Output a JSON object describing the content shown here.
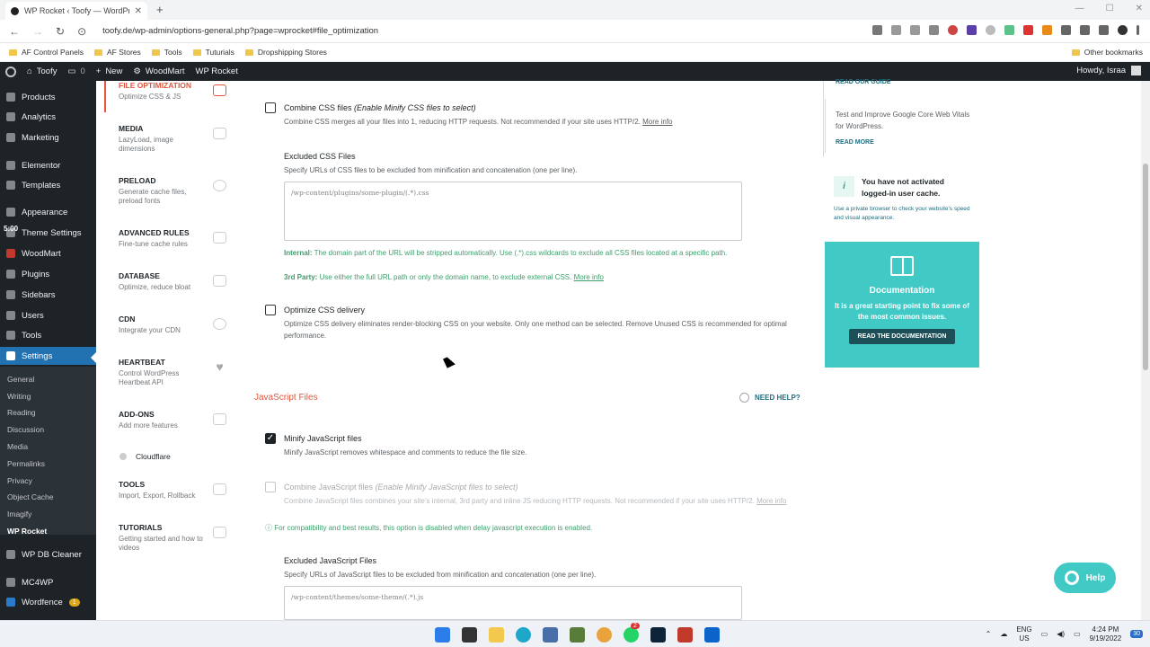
{
  "browser": {
    "tab_title": "WP Rocket ‹ Toofy — WordPress",
    "url": "toofy.de/wp-admin/options-general.php?page=wprocket#file_optimization",
    "bookmarks": [
      "AF Control Panels",
      "AF Stores",
      "Tools",
      "Tuturials",
      "Dropshipping Stores"
    ],
    "other_bookmarks": "Other bookmarks"
  },
  "adminbar": {
    "site": "Toofy",
    "comments": "0",
    "new": "New",
    "woodmart": "WoodMart",
    "wprocket": "WP Rocket",
    "howdy": "Howdy, Israa"
  },
  "wp_menu": {
    "items": [
      "Products",
      "Analytics",
      "Marketing",
      "Elementor",
      "Templates",
      "Appearance",
      "Theme Settings",
      "WoodMart",
      "Plugins",
      "Sidebars",
      "Users",
      "Tools",
      "Settings"
    ],
    "overlay_time": "5:00",
    "submenu": [
      "General",
      "Writing",
      "Reading",
      "Discussion",
      "Media",
      "Permalinks",
      "Privacy",
      "Object Cache",
      "Imagify",
      "WP Rocket"
    ],
    "after": [
      "WP DB Cleaner",
      "MC4WP",
      "Wordfence"
    ],
    "wordfence_badge": "1"
  },
  "rocket_nav": [
    {
      "title": "FILE OPTIMIZATION",
      "sub": "Optimize CSS & JS"
    },
    {
      "title": "MEDIA",
      "sub": "LazyLoad, image dimensions"
    },
    {
      "title": "PRELOAD",
      "sub": "Generate cache files, preload fonts"
    },
    {
      "title": "ADVANCED RULES",
      "sub": "Fine-tune cache rules"
    },
    {
      "title": "DATABASE",
      "sub": "Optimize, reduce bloat"
    },
    {
      "title": "CDN",
      "sub": "Integrate your CDN"
    },
    {
      "title": "HEARTBEAT",
      "sub": "Control WordPress Heartbeat API"
    },
    {
      "title": "ADD-ONS",
      "sub": "Add more features"
    },
    {
      "title": "TOOLS",
      "sub": "Import, Export, Rollback"
    },
    {
      "title": "TUTORIALS",
      "sub": "Getting started and how to videos"
    }
  ],
  "cloudflare": "Cloudflare",
  "main": {
    "combine_css": {
      "label": "Combine CSS files",
      "hint": "(Enable Minify CSS files to select)",
      "desc": "Combine CSS merges all your files into 1, reducing HTTP requests. Not recommended if your site uses HTTP/2.",
      "more": "More info"
    },
    "excluded_css": {
      "title": "Excluded CSS Files",
      "desc": "Specify URLs of CSS files to be excluded from minification and concatenation (one per line).",
      "placeholder": "/wp-content/plugins/some-plugin/(.*).css"
    },
    "css_internal_label": "Internal:",
    "css_internal": "The domain part of the URL will be stripped automatically. Use (.*).css wildcards to exclude all CSS files located at a specific path.",
    "css_third_label": "3rd Party:",
    "css_third": "Use either the full URL path or only the domain name, to exclude external CSS.",
    "css_third_more": "More info",
    "optimize_css": {
      "label": "Optimize CSS delivery",
      "desc": "Optimize CSS delivery eliminates render-blocking CSS on your website. Only one method can be selected. Remove Unused CSS is recommended for optimal performance."
    },
    "js_section": "JavaScript Files",
    "need_help": "NEED HELP?",
    "minify_js": {
      "label": "Minify JavaScript files",
      "desc": "Minify JavaScript removes whitespace and comments to reduce the file size."
    },
    "combine_js": {
      "label": "Combine JavaScript files",
      "hint": "(Enable Minify JavaScript files to select)",
      "desc": "Combine JavaScript files combines your site's internal, 3rd party and inline JS reducing HTTP requests. Not recommended if your site uses HTTP/2.",
      "more": "More info"
    },
    "compat_note": "For compatibility and best results, this option is disabled when delay javascript execution is enabled.",
    "excluded_js": {
      "title": "Excluded JavaScript Files",
      "desc": "Specify URLs of JavaScript files to be excluded from minification and concatenation (one per line).",
      "placeholder": "/wp-content/themes/some-theme/(.*).js"
    }
  },
  "aside": {
    "read_guide": "READ OUR GUIDE",
    "core_vitals": "Test and Improve Google Core Web Vitals for WordPress.",
    "read_more": "READ MORE",
    "notice": "You have not activated logged-in user cache.",
    "notice_sub": "Use a private browser to check your website's speed and visual appearance.",
    "doc_title": "Documentation",
    "doc_text": "It is a great starting point to fix some of the most common issues.",
    "doc_button": "READ THE DOCUMENTATION"
  },
  "help_button": "Help",
  "taskbar": {
    "lang": "ENG",
    "region": "US",
    "time": "4:24 PM",
    "date": "9/19/2022",
    "notif": "30",
    "chrome_badge": "2"
  },
  "colors": {
    "accent": "#e2563e",
    "teal": "#40c9c5",
    "wp_dark": "#1d2327",
    "wp_blue": "#2271b1"
  }
}
